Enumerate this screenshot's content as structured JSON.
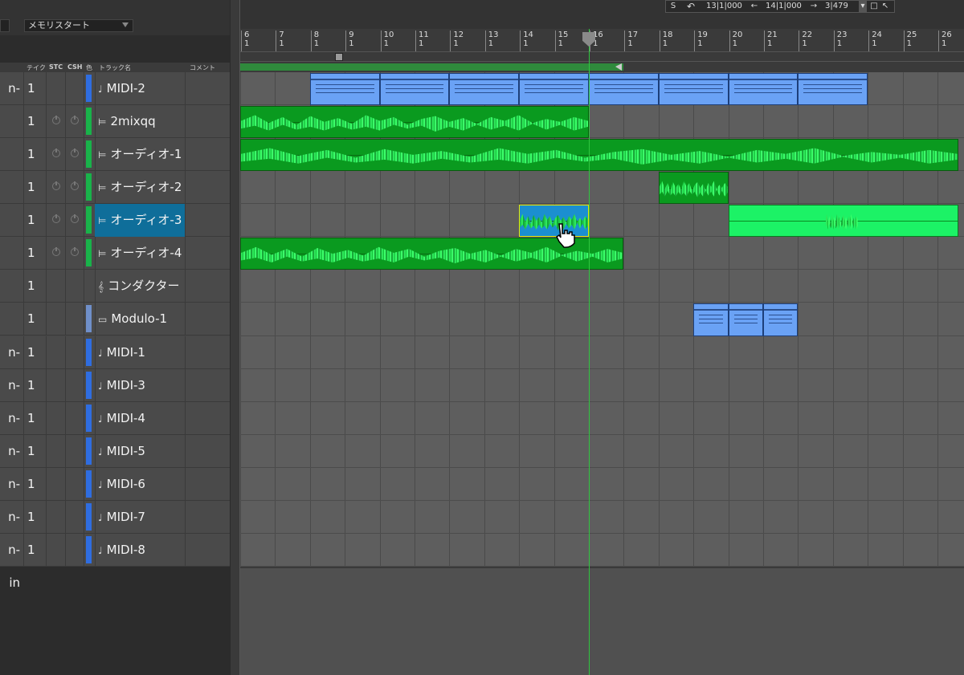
{
  "header": {
    "left_dropdown": "",
    "memory_dropdown": "メモリスタート",
    "transport": {
      "s_label": "S",
      "undo_icon": "undo-icon",
      "position_start": "13|1|000",
      "position_end": "14|1|000",
      "length": "3|479"
    }
  },
  "columns": {
    "take": "テイク",
    "stc": "STC",
    "csh": "CSH",
    "color": "色",
    "track_name": "トラック名",
    "comment": "コメント"
  },
  "ruler": {
    "bars": [
      {
        "n": "6",
        "b": "1"
      },
      {
        "n": "7",
        "b": "1"
      },
      {
        "n": "8",
        "b": "1"
      },
      {
        "n": "9",
        "b": "1"
      },
      {
        "n": "10",
        "b": "1"
      },
      {
        "n": "11",
        "b": "1"
      },
      {
        "n": "12",
        "b": "1"
      },
      {
        "n": "13",
        "b": "1"
      },
      {
        "n": "14",
        "b": "1"
      },
      {
        "n": "15",
        "b": "1"
      },
      {
        "n": "16",
        "b": "1"
      },
      {
        "n": "17",
        "b": "1"
      },
      {
        "n": "18",
        "b": "1"
      },
      {
        "n": "19",
        "b": "1"
      },
      {
        "n": "20",
        "b": "1"
      },
      {
        "n": "21",
        "b": "1"
      },
      {
        "n": "22",
        "b": "1"
      },
      {
        "n": "23",
        "b": "1"
      },
      {
        "n": "24",
        "b": "1"
      },
      {
        "n": "25",
        "b": "1"
      },
      {
        "n": "26",
        "b": "1"
      }
    ]
  },
  "tracks": [
    {
      "input": "n-in",
      "take": "1",
      "name": "MIDI-2",
      "icon": "♩",
      "kind": "midi",
      "color": "#2f6de0",
      "power": false,
      "selected": false
    },
    {
      "input": "",
      "take": "1",
      "name": "2mixqq",
      "icon": "⊨",
      "kind": "audio",
      "color": "#19b34a",
      "power": true,
      "selected": false
    },
    {
      "input": "",
      "take": "1",
      "name": "オーディオ-1",
      "icon": "⊨",
      "kind": "audio",
      "color": "#19b34a",
      "power": true,
      "selected": false
    },
    {
      "input": "",
      "take": "1",
      "name": "オーディオ-2",
      "icon": "⊨",
      "kind": "audio",
      "color": "#19b34a",
      "power": true,
      "selected": false
    },
    {
      "input": "",
      "take": "1",
      "name": "オーディオ-3",
      "icon": "⊨",
      "kind": "audio",
      "color": "#19b34a",
      "power": true,
      "selected": true
    },
    {
      "input": "",
      "take": "1",
      "name": "オーディオ-4",
      "icon": "⊨",
      "kind": "audio",
      "color": "#19b34a",
      "power": true,
      "selected": false
    },
    {
      "input": "",
      "take": "1",
      "name": "コンダクター",
      "icon": "𝄞",
      "kind": "conductor",
      "color": "",
      "power": false,
      "selected": false
    },
    {
      "input": "",
      "take": "1",
      "name": "Modulo-1",
      "icon": "▭",
      "kind": "instrument",
      "color": "#6f8fc9",
      "power": false,
      "selected": false
    },
    {
      "input": "n-in",
      "take": "1",
      "name": "MIDI-1",
      "icon": "♩",
      "kind": "midi",
      "color": "#2f6de0",
      "power": false,
      "selected": false
    },
    {
      "input": "n-in",
      "take": "1",
      "name": "MIDI-3",
      "icon": "♩",
      "kind": "midi",
      "color": "#2f6de0",
      "power": false,
      "selected": false
    },
    {
      "input": "n-in",
      "take": "1",
      "name": "MIDI-4",
      "icon": "♩",
      "kind": "midi",
      "color": "#2f6de0",
      "power": false,
      "selected": false
    },
    {
      "input": "n-in",
      "take": "1",
      "name": "MIDI-5",
      "icon": "♩",
      "kind": "midi",
      "color": "#2f6de0",
      "power": false,
      "selected": false
    },
    {
      "input": "n-in",
      "take": "1",
      "name": "MIDI-6",
      "icon": "♩",
      "kind": "midi",
      "color": "#2f6de0",
      "power": false,
      "selected": false
    },
    {
      "input": "n-in",
      "take": "1",
      "name": "MIDI-7",
      "icon": "♩",
      "kind": "midi",
      "color": "#2f6de0",
      "power": false,
      "selected": false
    },
    {
      "input": "n-in",
      "take": "1",
      "name": "MIDI-8",
      "icon": "♩",
      "kind": "midi",
      "color": "#2f6de0",
      "power": false,
      "selected": false
    }
  ],
  "regions": [
    {
      "track": 0,
      "type": "midi",
      "start": 8,
      "bars": [
        2,
        2,
        2,
        2,
        2,
        2,
        2,
        2
      ]
    },
    {
      "track": 1,
      "type": "audio",
      "start": 6,
      "end": 16
    },
    {
      "track": 2,
      "type": "audio",
      "start": 6,
      "end": 26.6
    },
    {
      "track": 3,
      "type": "audio",
      "start": 18,
      "end": 20
    },
    {
      "track": 4,
      "type": "audio_selected",
      "start": 14,
      "end": 16
    },
    {
      "track": 4,
      "type": "audio_bright",
      "start": 20,
      "end": 26.6
    },
    {
      "track": 5,
      "type": "audio",
      "start": 6,
      "end": 17
    },
    {
      "track": 7,
      "type": "midi",
      "start": 19,
      "bars": [
        1,
        1,
        1
      ]
    }
  ],
  "loop": {
    "start": 6,
    "end": 17
  },
  "playhead_bar": 16,
  "colors": {
    "accent": "#0f6e9a",
    "midi": "#6aa2f5",
    "audio": "#0a9a1f",
    "playhead": "#2fc63f"
  }
}
